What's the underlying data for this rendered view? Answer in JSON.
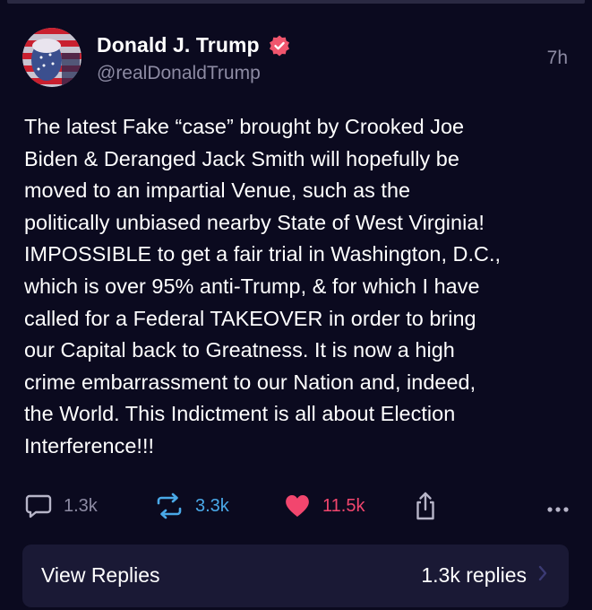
{
  "post": {
    "display_name": "Donald J. Trump",
    "handle": "@realDonaldTrump",
    "timestamp": "7h",
    "body_lines": [
      "The latest Fake “case” brought by Crooked Joe",
      "Biden & Deranged Jack Smith will hopefully be",
      "moved to an impartial Venue, such as the",
      "politically unbiased nearby State of West Virginia!",
      "IMPOSSIBLE to get a fair trial in Washington, D.C.,",
      "which is over 95% anti-Trump, & for which I have",
      "called for a Federal TAKEOVER in order to bring",
      "our Capital back to Greatness. It is now a high",
      "crime embarrassment to our Nation and, indeed,",
      "the World. This Indictment is all about Election",
      "Interference!!!"
    ]
  },
  "actions": {
    "replies": "1.3k",
    "reposts": "3.3k",
    "likes": "11.5k"
  },
  "view_replies": {
    "label": "View Replies",
    "count": "1.3k replies"
  },
  "icons": {
    "verified": "verified-badge-icon",
    "reply": "speech-bubble-icon",
    "repost": "repost-arrows-icon",
    "like": "heart-icon",
    "share": "share-icon",
    "more": "more-dots-icon",
    "chevron": "chevron-right-icon"
  },
  "colors": {
    "background": "#0b0a1f",
    "card": "#1a1935",
    "muted_text": "#8d8ba3",
    "repost": "#4aa9e8",
    "like": "#f2466e",
    "verified": "#f0556d"
  }
}
